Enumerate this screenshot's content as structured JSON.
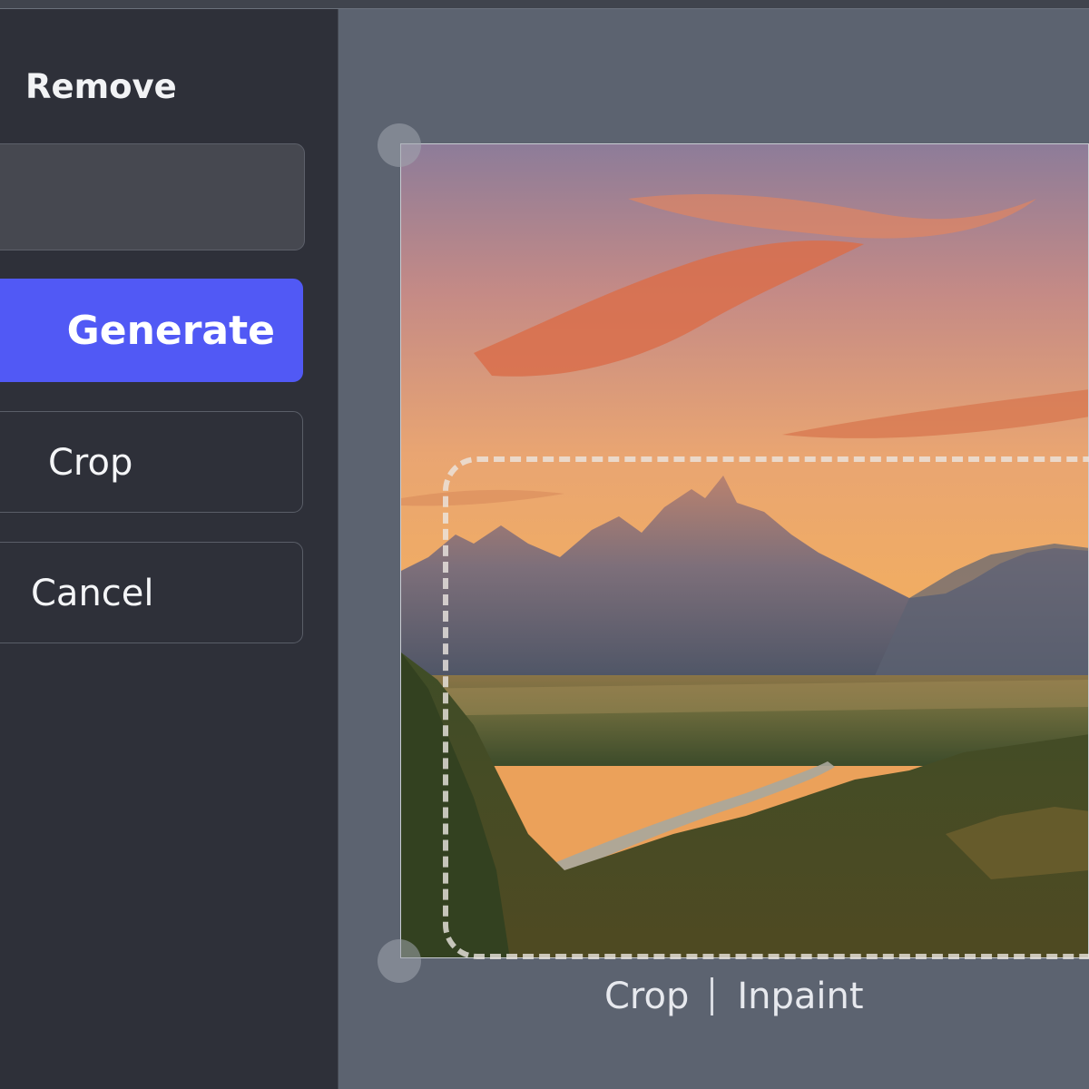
{
  "sidebar": {
    "title": "Remove",
    "prompt": {
      "value": ""
    },
    "buttons": {
      "generate": "Generate",
      "crop": "Crop",
      "cancel": "Cancel"
    }
  },
  "canvas": {
    "modes": [
      "Crop",
      "Inpaint"
    ],
    "active_mode": "Crop"
  },
  "colors": {
    "accent": "#5159f5",
    "sidebar_bg": "#2e3039",
    "canvas_bg": "#5c6370"
  }
}
